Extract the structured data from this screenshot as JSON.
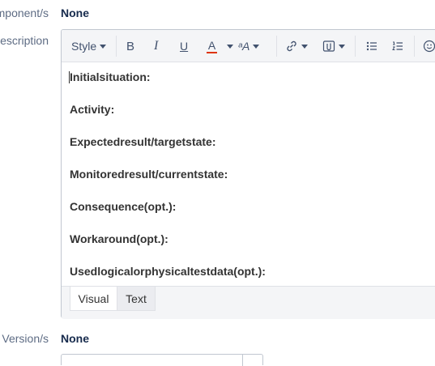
{
  "components": {
    "label": "Component/s",
    "value": "None"
  },
  "description": {
    "label": "Description",
    "toolbar": {
      "style_label": "Style",
      "bold": "B",
      "italic": "I",
      "underline": "U",
      "text_color": "A",
      "text_color_swatch": "#de350b",
      "more_formatting": "ᵃA"
    },
    "lines": [
      "Initialsituation:",
      "Activity:",
      "Expectedresult/targetstate:",
      "Monitoredresult/currentstate:",
      "Consequence(opt.):",
      "Workaround(opt.):",
      "Usedlogicalorphysicaltestdata(opt.):"
    ],
    "modes": {
      "visual": "Visual",
      "text": "Text",
      "active": "Visual"
    }
  },
  "fix_versions": {
    "label": "Fix Version/s",
    "value": "None"
  }
}
